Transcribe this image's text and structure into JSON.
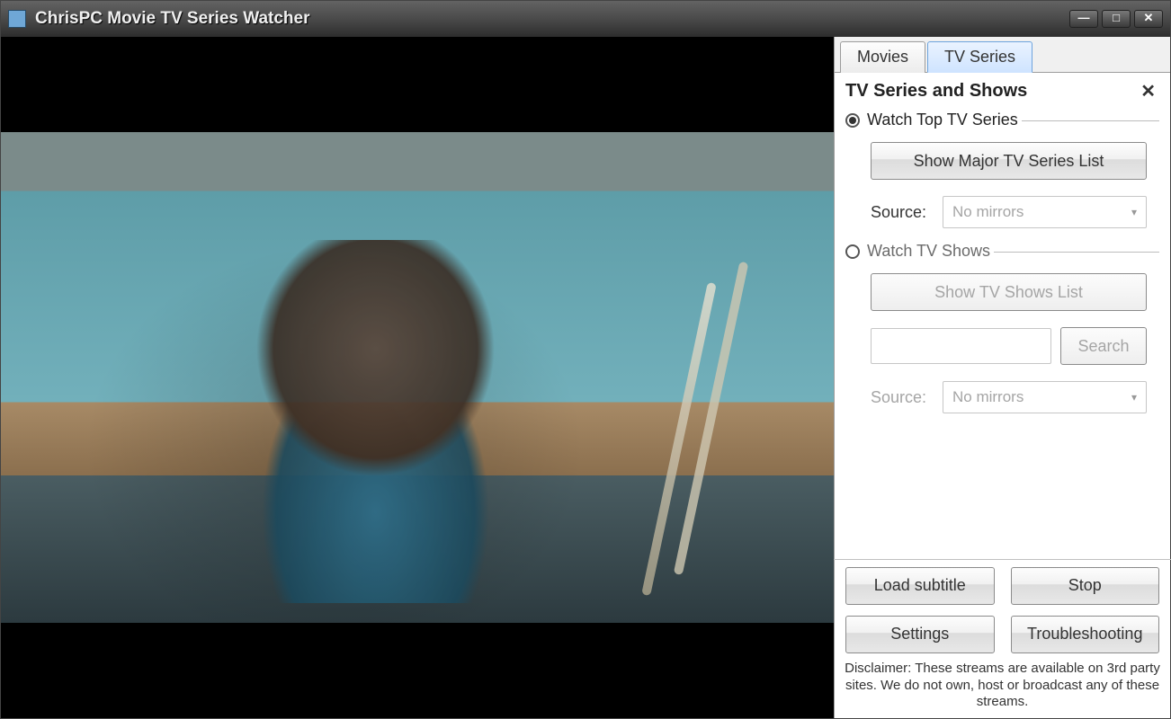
{
  "window": {
    "title": "ChrisPC Movie TV Series Watcher",
    "controls": {
      "minimize": "—",
      "maximize": "□",
      "close": "✕"
    }
  },
  "tabs": {
    "movies": "Movies",
    "tvseries": "TV Series",
    "active": "tvseries"
  },
  "panel": {
    "title": "TV Series and Shows",
    "close": "✕",
    "group_top": {
      "radio_label": "Watch Top TV Series",
      "show_list_btn": "Show Major TV Series List",
      "source_label": "Source:",
      "source_value": "No mirrors"
    },
    "group_shows": {
      "radio_label": "Watch TV Shows",
      "show_list_btn": "Show TV Shows List",
      "search_btn": "Search",
      "source_label": "Source:",
      "source_value": "No mirrors"
    }
  },
  "buttons": {
    "load_subtitle": "Load subtitle",
    "stop": "Stop",
    "settings": "Settings",
    "troubleshooting": "Troubleshooting"
  },
  "disclaimer": "Disclaimer: These streams are available on 3rd party sites. We do not own, host or broadcast any of these streams."
}
